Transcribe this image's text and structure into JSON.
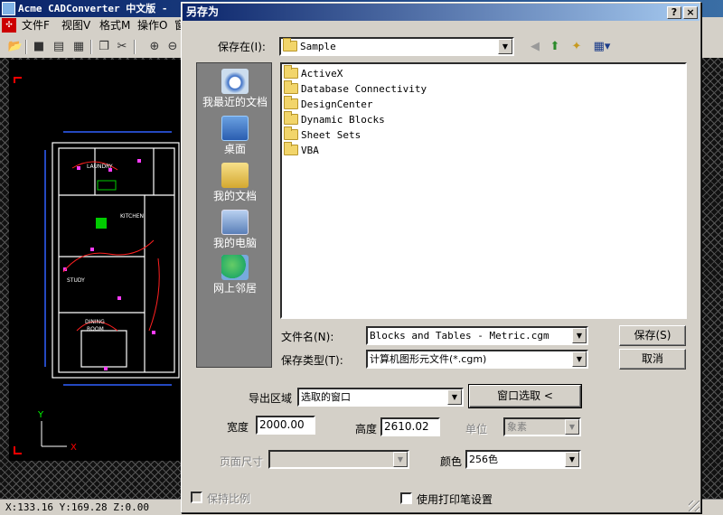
{
  "app": {
    "title": "Acme CADConverter 中文版 -",
    "menu": [
      "文件F",
      "视图V",
      "格式M",
      "操作O",
      "窗"
    ],
    "status": "X:133.16 Y:169.28 Z:0.00"
  },
  "dialog": {
    "title": "另存为",
    "help_btn": "?",
    "close_btn": "×",
    "save_in_label": "保存在(I):",
    "save_in_value": "Sample",
    "places": [
      {
        "label": "我最近的文档",
        "icon": "recent-documents-icon"
      },
      {
        "label": "桌面",
        "icon": "desktop-icon"
      },
      {
        "label": "我的文档",
        "icon": "my-documents-icon"
      },
      {
        "label": "我的电脑",
        "icon": "my-computer-icon"
      },
      {
        "label": "网上邻居",
        "icon": "network-places-icon"
      }
    ],
    "folders": [
      "ActiveX",
      "Database Connectivity",
      "DesignCenter",
      "Dynamic Blocks",
      "Sheet Sets",
      "VBA"
    ],
    "filename_label": "文件名(N):",
    "filename_value": "Blocks and Tables - Metric.cgm",
    "filetype_label": "保存类型(T):",
    "filetype_value": "计算机图形元文件(*.cgm)",
    "save_btn": "保存(S)",
    "cancel_btn": "取消",
    "export_area_label": "导出区域",
    "export_area_value": "选取的窗口",
    "window_select_btn": "窗口选取 <",
    "width_label": "宽度",
    "width_value": "2000.00",
    "height_label": "高度",
    "height_value": "2610.02",
    "unit_label": "单位",
    "unit_value": "象素",
    "page_size_label": "页面尺寸",
    "page_size_value": "",
    "color_label": "颜色",
    "color_value": "256色",
    "keep_ratio_label": "保持比例",
    "use_pen_label": "使用打印笔设置"
  }
}
